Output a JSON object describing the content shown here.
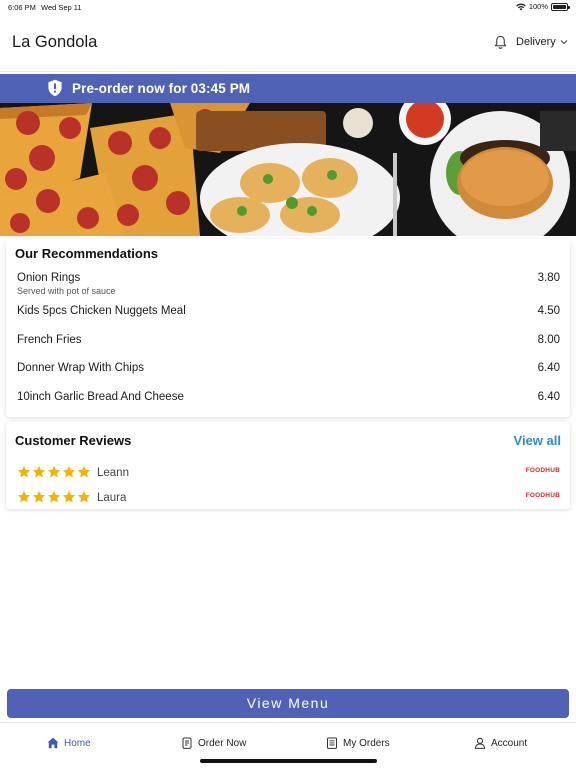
{
  "status_bar": {
    "time": "6:06 PM",
    "date": "Wed Sep 11",
    "battery": "100%"
  },
  "header": {
    "title": "La Gondola",
    "delivery_label": "Delivery"
  },
  "banner": {
    "text": "Pre-order now for 03:45 PM",
    "color": "#5062b6"
  },
  "recommendations": {
    "title": "Our Recommendations",
    "items": [
      {
        "name": "Onion Rings",
        "description": "Served with pot of sauce",
        "price": "3.80"
      },
      {
        "name": "Kids 5pcs Chicken Nuggets Meal",
        "description": "",
        "price": "4.50"
      },
      {
        "name": "French Fries",
        "description": "",
        "price": "8.00"
      },
      {
        "name": "Donner Wrap With Chips",
        "description": "",
        "price": "6.40"
      },
      {
        "name": "10inch Garlic Bread And Cheese",
        "description": "",
        "price": "6.40"
      }
    ]
  },
  "reviews": {
    "title": "Customer Reviews",
    "view_all": "View all",
    "items": [
      {
        "name": "Leann",
        "rating": 5,
        "source": "FOODHUB"
      },
      {
        "name": "Laura",
        "rating": 5,
        "source": "FOODHUB"
      }
    ],
    "star_color": "#f5b301",
    "source_color": "#e5202e"
  },
  "view_menu_button": "View Menu",
  "tabbar": {
    "tabs": [
      {
        "label": "Home",
        "icon": "home-icon",
        "active": true
      },
      {
        "label": "Order Now",
        "icon": "order-icon",
        "active": false
      },
      {
        "label": "My Orders",
        "icon": "receipt-icon",
        "active": false
      },
      {
        "label": "Account",
        "icon": "person-icon",
        "active": false
      }
    ],
    "active_color": "#3f58b8"
  }
}
